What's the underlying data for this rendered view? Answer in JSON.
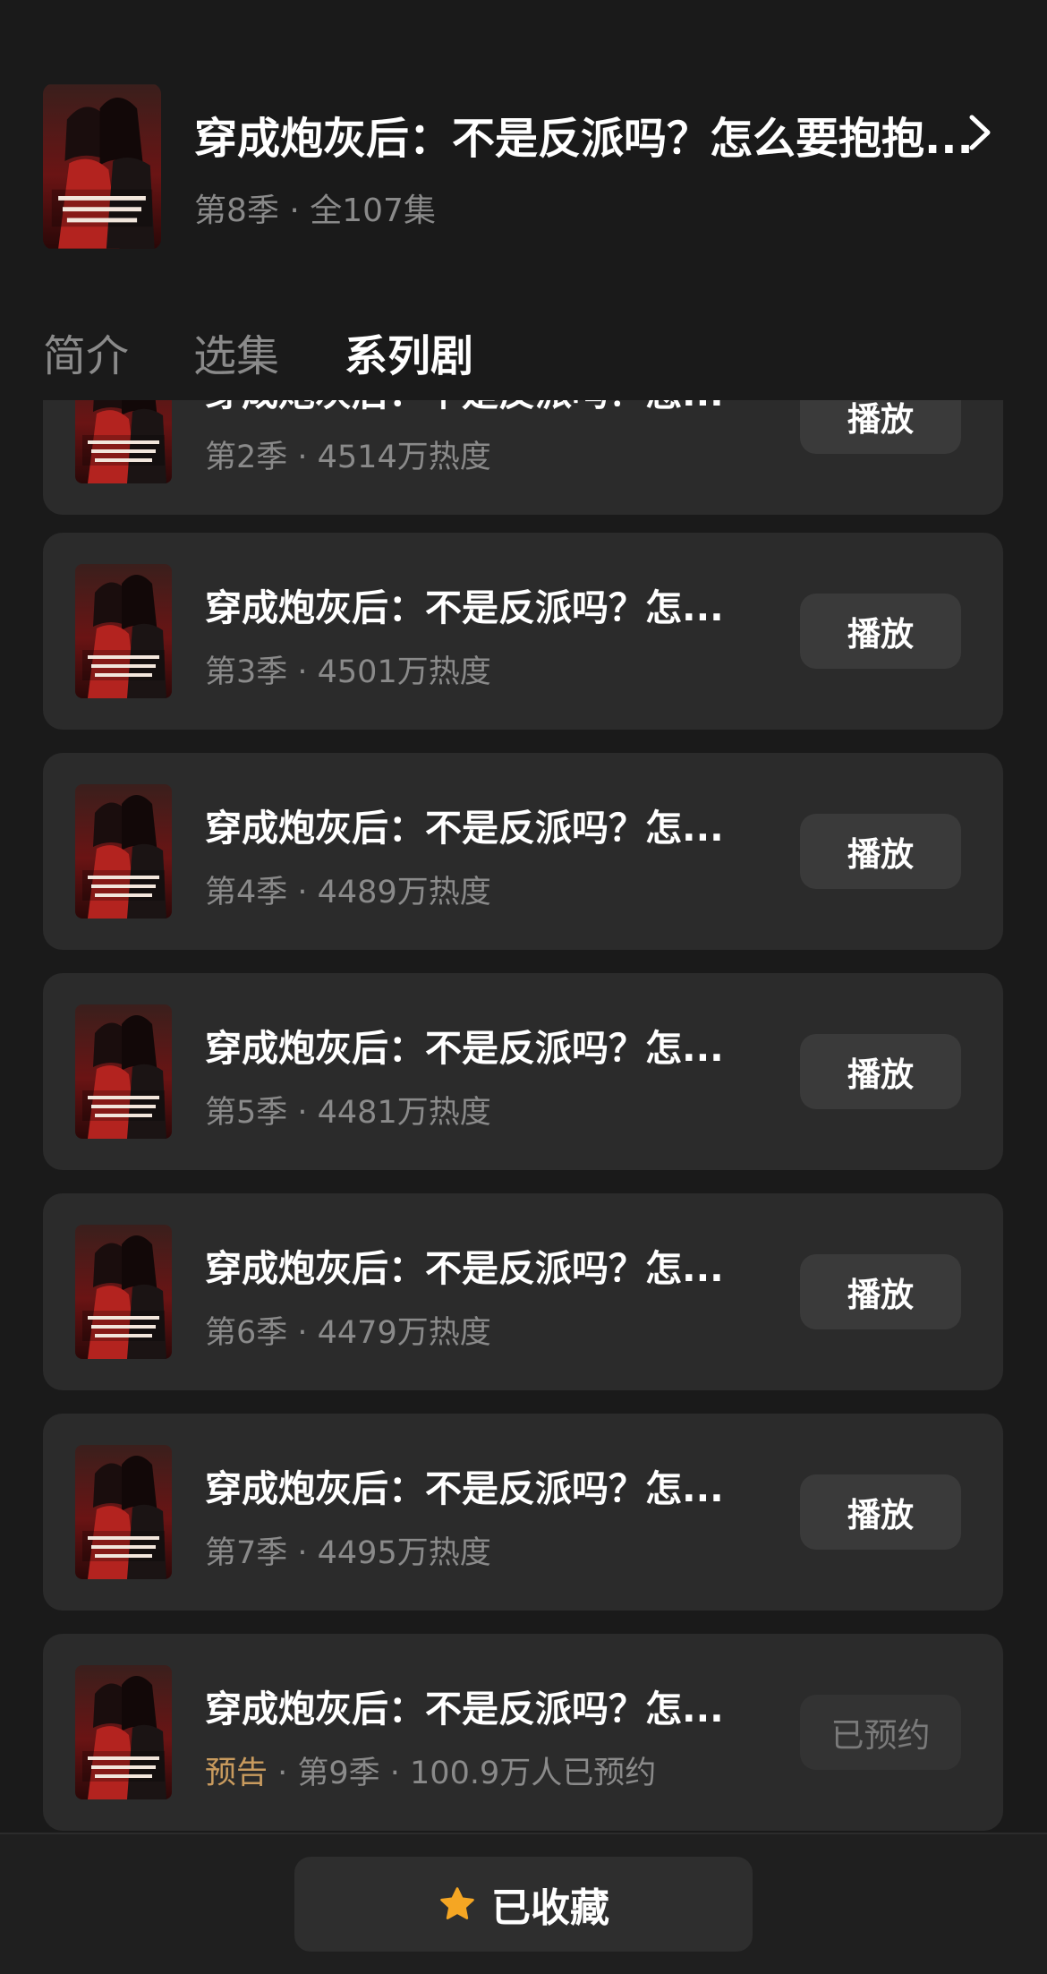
{
  "header": {
    "title": "穿成炮灰后：不是反派吗？怎么要抱抱...",
    "subtitle": "第8季 · 全107集",
    "cover_icon": "drama-cover-image",
    "chevron_icon": "chevron-right-icon"
  },
  "tabs": [
    {
      "label": "简介",
      "active": false
    },
    {
      "label": "选集",
      "active": false
    },
    {
      "label": "系列剧",
      "active": true
    }
  ],
  "series": [
    {
      "name": "穿成炮灰后：不是反派吗？怎...",
      "meta": "第2季 · 4514万热度",
      "button": "播放"
    },
    {
      "name": "穿成炮灰后：不是反派吗？怎...",
      "meta": "第3季 · 4501万热度",
      "button": "播放"
    },
    {
      "name": "穿成炮灰后：不是反派吗？怎...",
      "meta": "第4季 · 4489万热度",
      "button": "播放"
    },
    {
      "name": "穿成炮灰后：不是反派吗？怎...",
      "meta": "第5季 · 4481万热度",
      "button": "播放"
    },
    {
      "name": "穿成炮灰后：不是反派吗？怎...",
      "meta": "第6季 · 4479万热度",
      "button": "播放"
    },
    {
      "name": "穿成炮灰后：不是反派吗？怎...",
      "meta": "第7季 · 4495万热度",
      "button": "播放"
    },
    {
      "name": "穿成炮灰后：不是反派吗？怎...",
      "meta_tag": "预告",
      "meta": " · 第9季 · 100.9万人已预约",
      "button": "已预约"
    }
  ],
  "bottom": {
    "favorite_label": "已收藏",
    "star_icon": "star-icon"
  },
  "colors": {
    "background": "#1a1a1a",
    "card": "#2b2b2b",
    "button": "#3a3a3a",
    "secondary_text": "#8a8a8a",
    "accent": "#c99b5e",
    "star": "#f5a623"
  }
}
